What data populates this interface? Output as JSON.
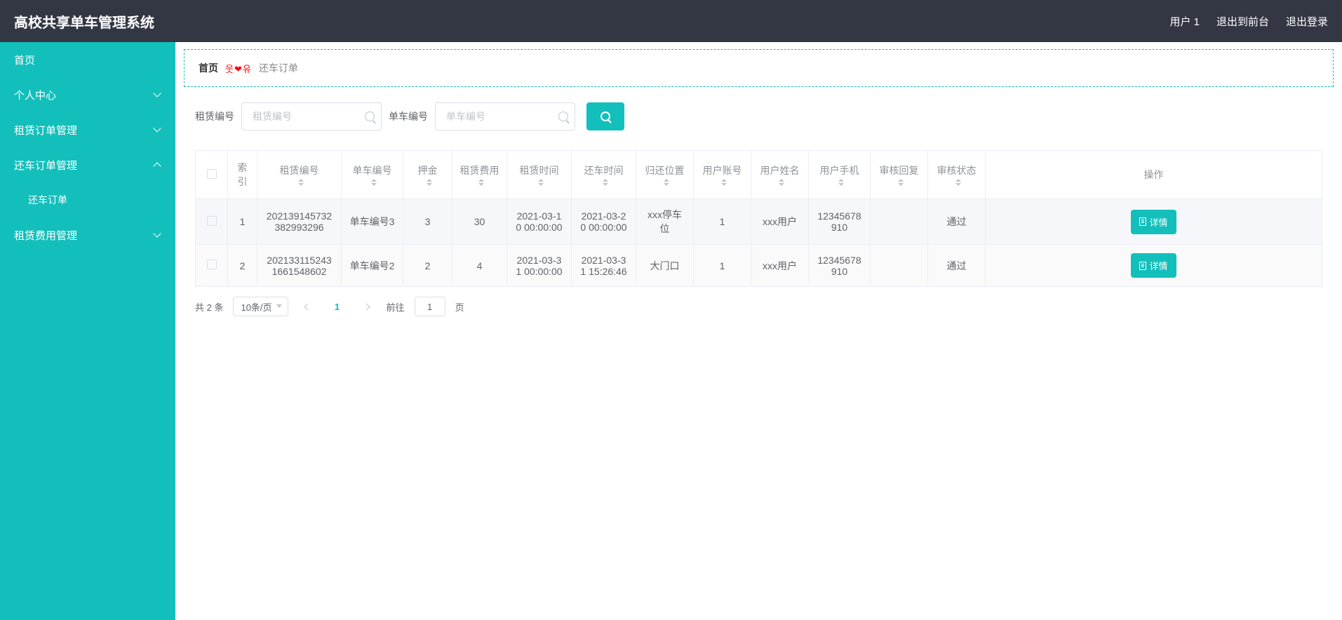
{
  "header": {
    "title": "高校共享单车管理系统",
    "user": "用户 1",
    "exit_front": "退出到前台",
    "logout": "退出登录"
  },
  "sidebar": {
    "home": "首页",
    "personal": "个人中心",
    "rental_order_mgmt": "租赁订单管理",
    "return_order_mgmt": "还车订单管理",
    "return_order_child": "还车订单",
    "rental_fee_mgmt": "租赁费用管理"
  },
  "breadcrumb": {
    "home": "首页",
    "sep": "웃❤유",
    "current": "还车订单"
  },
  "filter": {
    "rent_no_label": "租赁编号",
    "rent_no_placeholder": "租赁编号",
    "bike_no_label": "单车编号",
    "bike_no_placeholder": "单车编号"
  },
  "table": {
    "headers": {
      "index": "索引",
      "rent_no": "租赁编号",
      "bike_no": "单车编号",
      "deposit": "押金",
      "rent_fee": "租赁费用",
      "rent_time": "租赁时间",
      "return_time": "还车时间",
      "return_loc": "归还位置",
      "user_acct": "用户账号",
      "user_name": "用户姓名",
      "user_phone": "用户手机",
      "audit_reply": "审核回复",
      "audit_status": "审核状态",
      "action": "操作"
    },
    "rows": [
      {
        "index": "1",
        "rent_no": "202139145732382993296",
        "bike_no": "单车编号3",
        "deposit": "3",
        "rent_fee": "30",
        "rent_time": "2021-03-10 00:00:00",
        "return_time": "2021-03-20 00:00:00",
        "return_loc": "xxx停车位",
        "user_acct": "1",
        "user_name": "xxx用户",
        "user_phone": "12345678910",
        "audit_reply": "",
        "audit_status": "通过",
        "detail": "详情"
      },
      {
        "index": "2",
        "rent_no": "2021331152431661548602",
        "bike_no": "单车编号2",
        "deposit": "2",
        "rent_fee": "4",
        "rent_time": "2021-03-31 00:00:00",
        "return_time": "2021-03-31 15:26:46",
        "return_loc": "大门口",
        "user_acct": "1",
        "user_name": "xxx用户",
        "user_phone": "12345678910",
        "audit_reply": "",
        "audit_status": "通过",
        "detail": "详情"
      }
    ]
  },
  "pagination": {
    "total": "共 2 条",
    "per_page": "10条/页",
    "page_active": "1",
    "goto_prefix": "前往",
    "goto_value": "1",
    "goto_suffix": "页"
  }
}
